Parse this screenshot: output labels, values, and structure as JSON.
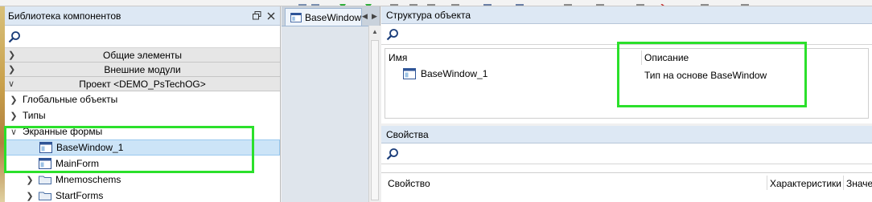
{
  "library": {
    "title": "Библиотека компонентов",
    "search_placeholder": "",
    "categories": [
      {
        "label": "Общие элементы"
      },
      {
        "label": "Внешние модули"
      },
      {
        "label": "Проект <DEMO_PsTechOG>"
      }
    ],
    "tree": [
      {
        "label": "Глобальные объекты",
        "expanded": false
      },
      {
        "label": "Типы",
        "expanded": false
      },
      {
        "label": "Экранные формы",
        "expanded": true
      }
    ],
    "forms": [
      {
        "label": "BaseWindow_1",
        "selected": true
      },
      {
        "label": "MainForm",
        "selected": false
      }
    ],
    "more": [
      {
        "label": "Mnemoschems"
      },
      {
        "label": "StartForms"
      }
    ]
  },
  "tab": {
    "label": "BaseWindow"
  },
  "object_structure": {
    "title": "Структура объекта",
    "col_name": "Имя",
    "col_description": "Описание",
    "rows": [
      {
        "name": "BaseWindow_1",
        "description": "Тип на основе BaseWindow"
      }
    ]
  },
  "properties": {
    "title": "Свойства",
    "col_property": "Свойство",
    "col_characteristics": "Характеристики",
    "col_value": "Значение"
  },
  "colors": {
    "highlight": "#2be02b",
    "header_bg": "#dde8f4",
    "selection_bg": "#cce4f7"
  }
}
